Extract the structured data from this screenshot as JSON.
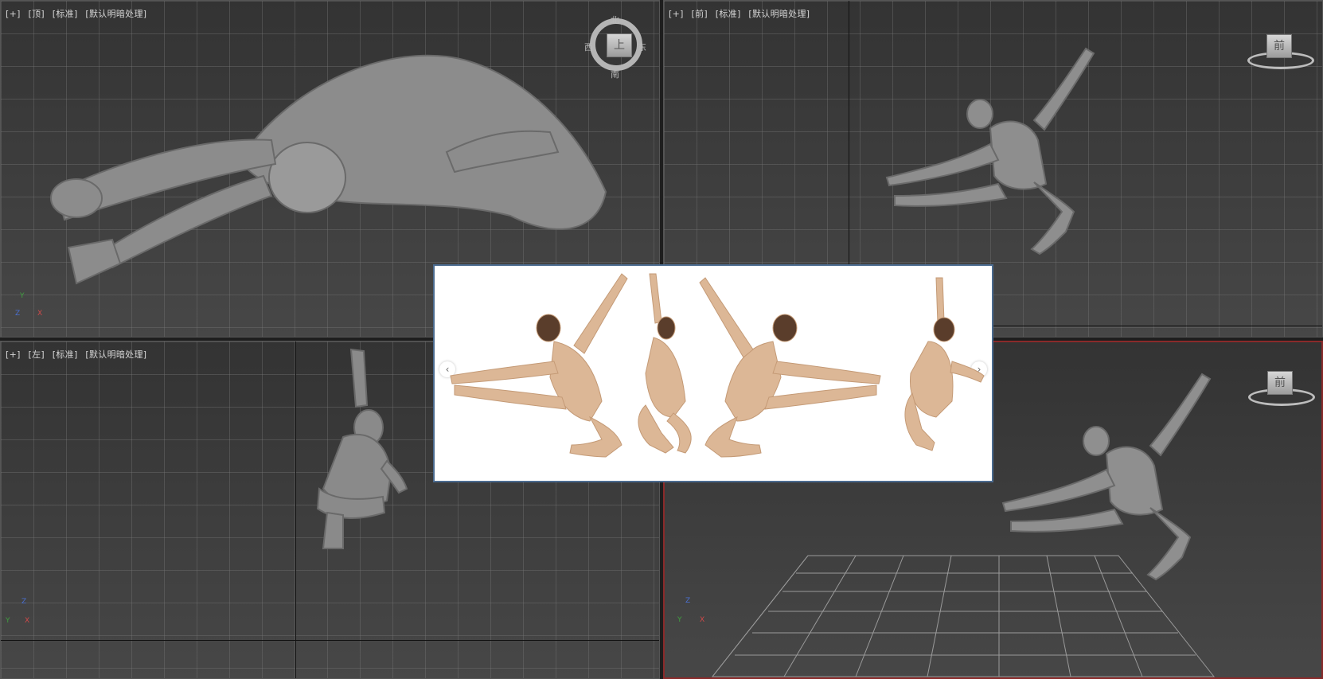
{
  "viewports": {
    "top": {
      "tokens": [
        "[+]",
        "[顶]",
        "[标准]",
        "[默认明暗处理]"
      ]
    },
    "front": {
      "tokens": [
        "[+]",
        "[前]",
        "[标准]",
        "[默认明暗处理]"
      ]
    },
    "left": {
      "tokens": [
        "[+]",
        "[左]",
        "[标准]",
        "[默认明暗处理]"
      ]
    },
    "persp": {
      "active": true
    }
  },
  "viewcube": {
    "top_face": "上",
    "front_face": "前",
    "persp_face": "前",
    "compass": {
      "north": "北",
      "south": "南",
      "east": "东",
      "west": "西"
    }
  },
  "gizmo": {
    "top": {
      "a": "Y",
      "b": "X",
      "c": "Z"
    },
    "left": {
      "a": "Z",
      "b": "Y",
      "c": "X"
    },
    "persp": {
      "a": "Z",
      "b": "X",
      "c": "Y"
    }
  },
  "reference_popup": {
    "prev_icon": "‹",
    "next_icon": "›",
    "image_count": 4
  },
  "colors": {
    "viewport_active_border": "#8a2a2a",
    "popup_border": "#4b6b8f",
    "model": "#8f8f8f",
    "skin": "#dcb796"
  }
}
